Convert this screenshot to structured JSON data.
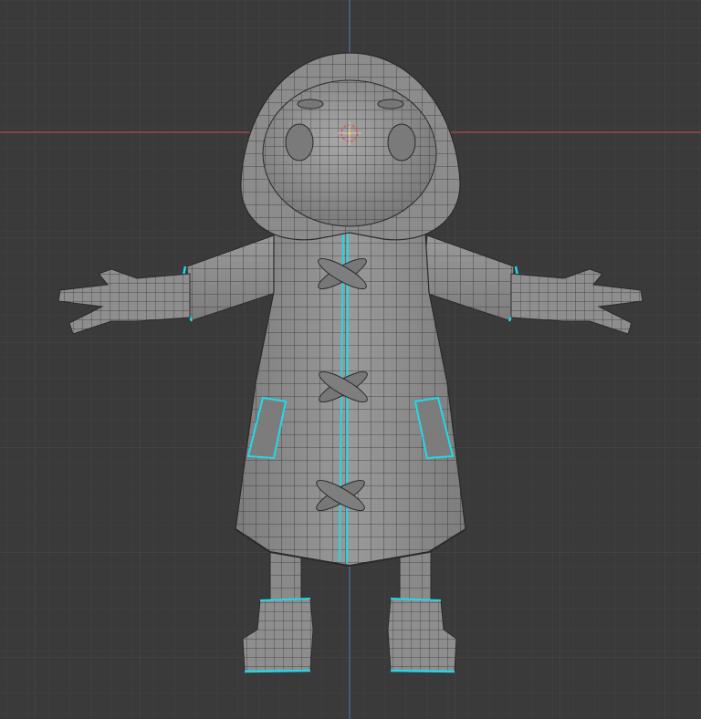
{
  "viewport": {
    "view": "front-orthographic",
    "background_color": "#3a3a3a",
    "grid_minor_color": "#404040",
    "grid_major_color": "#4a4a4a",
    "x_axis_color": "#b04b55",
    "z_axis_color": "#4d6fa8"
  },
  "model": {
    "object": "hooded-character-mesh",
    "shading": "solid-gray-with-wireframe",
    "base_color": "#8c8c8c",
    "wire_color": "#2a2a2a",
    "seam_color": "#22d8e8",
    "coat_toggles": 3,
    "pockets": 2
  },
  "origin": {
    "icon": "3d-cursor-icon",
    "color": "#e05a4a"
  }
}
